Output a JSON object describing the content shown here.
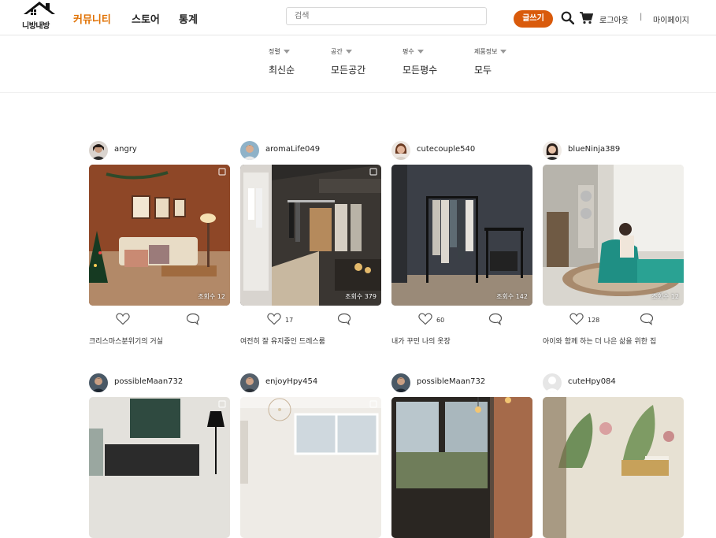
{
  "header": {
    "logo_text": "니방내방",
    "nav": [
      "커뮤니티",
      "스토어",
      "통계"
    ],
    "search_placeholder": "검색",
    "write_button": "글쓰기",
    "logout": "로그아웃",
    "separator": "|",
    "mypage": "마이페이지",
    "accent_color": "#d95a0b"
  },
  "filters": [
    {
      "label": "정렬",
      "value": "최신순"
    },
    {
      "label": "공간",
      "value": "모든공간"
    },
    {
      "label": "평수",
      "value": "모든평수"
    },
    {
      "label": "제품정보",
      "value": "모두"
    }
  ],
  "posts": [
    {
      "user": "angry",
      "views": "조회수 12",
      "likes": "",
      "caption": "크리스마스분위기의 거실"
    },
    {
      "user": "aromaLife049",
      "views": "조회수 379",
      "likes": "17",
      "caption": "여전히 잘 유지중인 드레스룸"
    },
    {
      "user": "cutecouple540",
      "views": "조회수 142",
      "likes": "60",
      "caption": "내가 꾸민 나의 옷장"
    },
    {
      "user": "blueNinja389",
      "views": "조회수 12",
      "likes": "128",
      "caption": "아이와 함께 하는 더 나은 삶을 위한 집"
    },
    {
      "user": "possibleMaan732",
      "views": "",
      "likes": "",
      "caption": ""
    },
    {
      "user": "enjoyHpy454",
      "views": "",
      "likes": "",
      "caption": ""
    },
    {
      "user": "possibleMaan732",
      "views": "",
      "likes": "",
      "caption": ""
    },
    {
      "user": "cuteHpy084",
      "views": "",
      "likes": "",
      "caption": ""
    }
  ]
}
